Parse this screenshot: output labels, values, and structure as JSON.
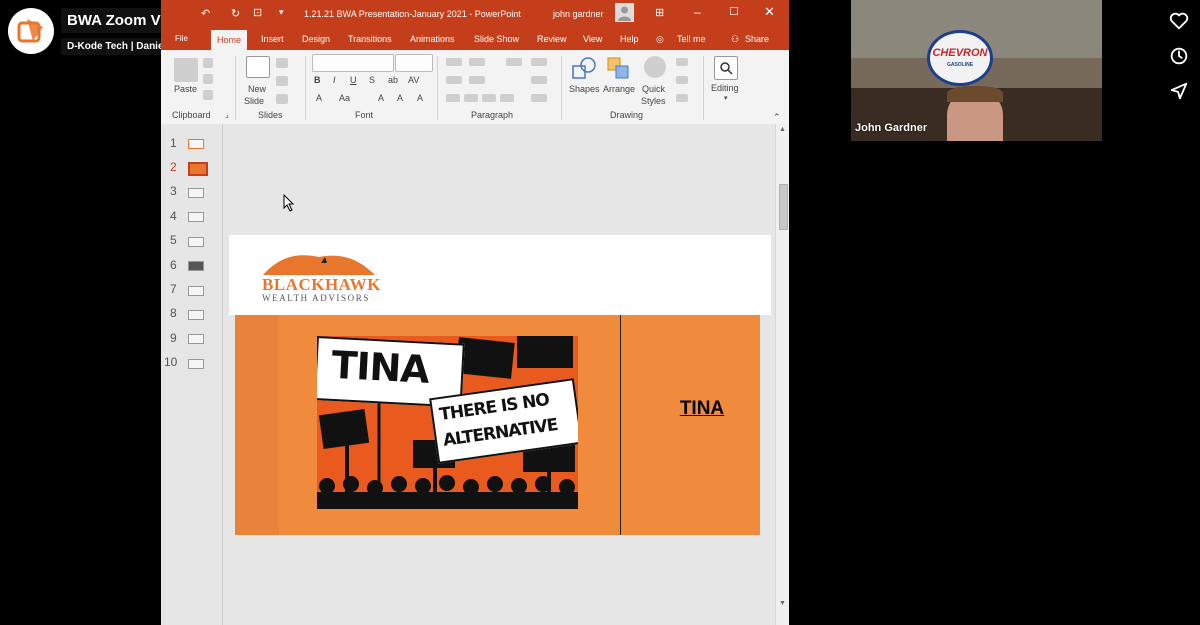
{
  "video": {
    "title": "BWA Zoom Video",
    "byline": "D-Kode Tech | Daniel Kodam"
  },
  "side_actions": [
    {
      "icon": "heart-icon"
    },
    {
      "icon": "clock-icon"
    },
    {
      "icon": "send-icon"
    }
  ],
  "ppt": {
    "doc_title": "1.21.21 BWA Presentation-January 2021 - PowerPoint",
    "user": "john gardner",
    "menu_first": "File",
    "tabs": [
      "Home",
      "Insert",
      "Design",
      "Transitions",
      "Animations",
      "Slide Show",
      "Review",
      "View",
      "Help",
      "Tell me",
      "Share"
    ],
    "ribbon": {
      "paste": "Paste",
      "new_slide": "New",
      "new_slide_2": "Slide",
      "shapes": "Shapes",
      "arrange": "Arrange",
      "quick": "Quick",
      "styles": "Styles",
      "editing": "Editing",
      "groups": [
        "Clipboard",
        "Slides",
        "Font",
        "Paragraph",
        "Drawing"
      ]
    },
    "slides": [
      "1",
      "2",
      "3",
      "4",
      "5",
      "6",
      "7",
      "8",
      "9",
      "10"
    ],
    "selected_slide": 2
  },
  "slide": {
    "logo_line1": "BLACKHAWK",
    "logo_line2": "WEALTH ADVISORS",
    "sign_tina": "TINA",
    "sign_line1": "THERE IS NO",
    "sign_line2": "ALTERNATIVE",
    "right_text": "TINA"
  },
  "webcam": {
    "name": "John Gardner",
    "sign_top": "CHEVRON",
    "sign_bottom": "GASOLINE"
  },
  "colors": {
    "ppt_accent": "#c43e1c",
    "slide_orange": "#f08b3e",
    "logo_orange": "#e8762d"
  }
}
